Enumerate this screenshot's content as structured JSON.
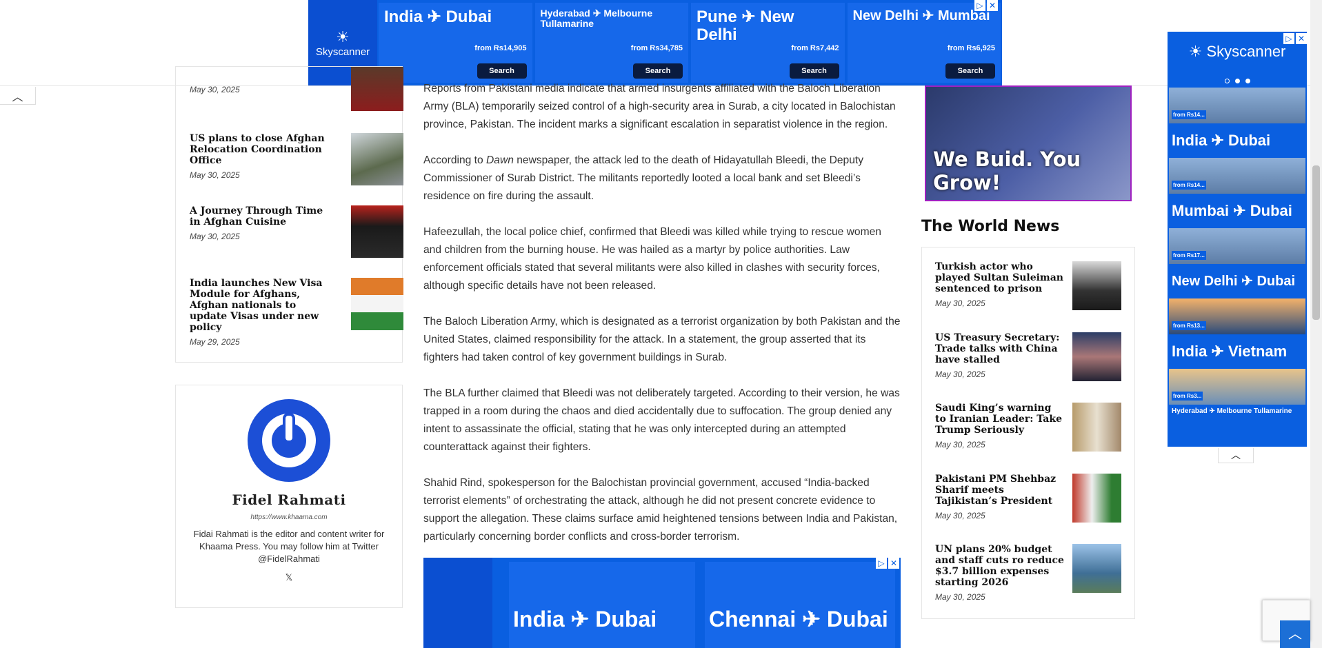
{
  "top_ad": {
    "brand": "Skyscanner",
    "cells": [
      {
        "route": "India ✈ Dubai",
        "price": "from Rs14,905",
        "button": "Search"
      },
      {
        "route": "Hyderabad ✈ Melbourne Tullamarine",
        "price": "from Rs34,785",
        "button": "Search"
      },
      {
        "route": "Pune ✈ New Delhi",
        "price": "from Rs7,442",
        "button": "Search"
      },
      {
        "route": "New Delhi ✈ Mumbai",
        "price": "from Rs6,925",
        "button": "Search"
      }
    ]
  },
  "left_posts": [
    {
      "title": "",
      "date": "May 30, 2025"
    },
    {
      "title": "US plans to close Afghan Relocation Coordination Office",
      "date": "May 30, 2025"
    },
    {
      "title": "A Journey Through Time in Afghan Cuisine",
      "date": "May 30, 2025"
    },
    {
      "title": "India launches New Visa Module for Afghans, Afghan nationals to update Visas under new policy",
      "date": "May 29, 2025"
    }
  ],
  "author": {
    "name": "Fidel Rahmati",
    "url": "https://www.khaama.com",
    "bio": "Fidai Rahmati is the editor and content writer for Khaama Press. You may follow him at Twitter @FidelRahmati",
    "social": "𝕏"
  },
  "article": {
    "p1": "Reports from Pakistani media indicate that armed insurgents affiliated with the Baloch Liberation Army (BLA) temporarily seized control of a high-security area in Surab, a city located in Balochistan province, Pakistan. The incident marks a significant escalation in separatist violence in the region.",
    "p2_pre": "According to ",
    "p2_em": "Dawn",
    "p2_post": " newspaper, the attack led to the death of Hidayatullah Bleedi, the Deputy Commissioner of Surab District. The militants reportedly looted a local bank and set Bleedi’s residence on fire during the assault.",
    "p3": "Hafeezullah, the local police chief, confirmed that Bleedi was killed while trying to rescue women and children from the burning house. He was hailed as a martyr by police authorities. Law enforcement officials stated that several militants were also killed in clashes with security forces, although specific details have not been released.",
    "p4": "The Baloch Liberation Army, which is designated as a terrorist organization by both Pakistan and the United States, claimed responsibility for the attack. In a statement, the group asserted that its fighters had taken control of key government buildings in Surab.",
    "p5": "The BLA further claimed that Bleedi was not deliberately targeted. According to their version, he was trapped in a room during the chaos and died accidentally due to suffocation. The group denied any intent to assassinate the official, stating that he was only intercepted during an attempted counterattack against their fighters.",
    "p6": "Shahid Rind, spokesperson for the Balochistan provincial government, accused “India-backed terrorist elements” of orchestrating the attack, although he did not present concrete evidence to support the allegation. These claims surface amid heightened tensions between India and Pakistan, particularly concerning border conflicts and cross-border terrorism."
  },
  "bottom_ad": {
    "route1": "India ✈ Dubai",
    "route2": "Chennai ✈ Dubai"
  },
  "promo": {
    "caption": "We Buid. You Grow!"
  },
  "world_news": {
    "title": "The World News",
    "items": [
      {
        "title": "Turkish actor who played Sultan Suleiman sentenced to prison",
        "date": "May 30, 2025"
      },
      {
        "title": "US Treasury Secretary: Trade talks with China have stalled",
        "date": "May 30, 2025"
      },
      {
        "title": "Saudi King’s warning to Iranian Leader: Take Trump Seriously",
        "date": "May 30, 2025"
      },
      {
        "title": "Pakistani PM Shehbaz Sharif meets Tajikistan’s President",
        "date": "May 30, 2025"
      },
      {
        "title": "UN plans 20% budget and staff cuts ro reduce $3.7 billion expenses starting 2026",
        "date": "May 30, 2025"
      }
    ]
  },
  "sky_ad": {
    "brand": "Skyscanner",
    "price_labels": [
      "from Rs14...",
      "from Rs14...",
      "from Rs17...",
      "from Rs13...",
      "from Rs3..."
    ],
    "routes": [
      "India ✈ Dubai",
      "Mumbai ✈ Dubai",
      "New Delhi ✈ Dubai",
      "India ✈ Vietnam"
    ],
    "last_route": "Hyderabad ✈ Melbourne Tullamarine"
  },
  "colors": {
    "accent": "#1c4fd6",
    "ad_blue": "#0a5fe0",
    "promo_border": "#a020c0"
  }
}
